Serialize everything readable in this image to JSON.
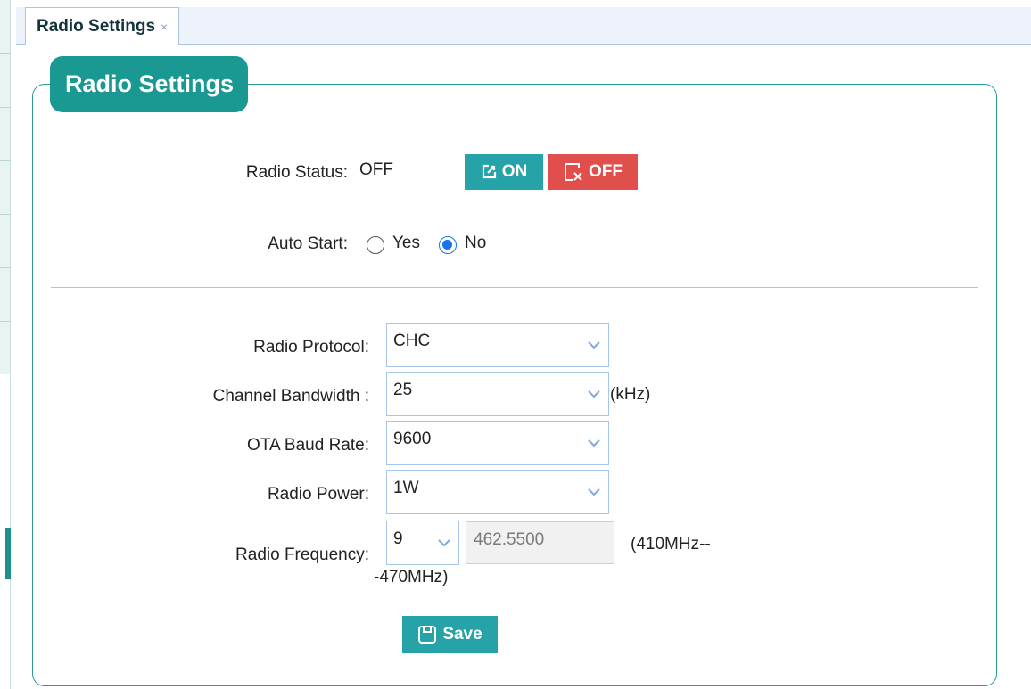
{
  "tabs": [
    {
      "label": "Radio Settings",
      "close": "×"
    }
  ],
  "panel": {
    "title": "Radio Settings"
  },
  "status": {
    "label": "Radio Status:",
    "value": "OFF",
    "on_button": "ON",
    "off_button": "OFF"
  },
  "auto_start": {
    "label": "Auto Start:",
    "options": [
      {
        "label": "Yes",
        "checked": false
      },
      {
        "label": "No",
        "checked": true
      }
    ]
  },
  "form": {
    "protocol": {
      "label": "Radio Protocol:",
      "value": "CHC"
    },
    "bandwidth": {
      "label": "Channel Bandwidth :",
      "value": "25",
      "unit": "(kHz)"
    },
    "baud_rate": {
      "label": "OTA Baud Rate:",
      "value": "9600"
    },
    "power": {
      "label": "Radio Power:",
      "value": "1W"
    },
    "frequency": {
      "label": "Radio Frequency:",
      "channel": "9",
      "value": "462.5500",
      "range_line1": "(410MHz--",
      "range_line2": "-470MHz)"
    }
  },
  "save_button": "Save",
  "colors": {
    "accent": "#1a9892",
    "on": "#25a3a8",
    "off": "#e14f4c",
    "radio_selected": "#1a73e8"
  },
  "icons": {
    "on": "edit-square-icon",
    "off": "close-square-icon",
    "save": "floppy-disk-icon",
    "dropdown": "chevron-down-icon",
    "tab_close": "close-icon"
  }
}
